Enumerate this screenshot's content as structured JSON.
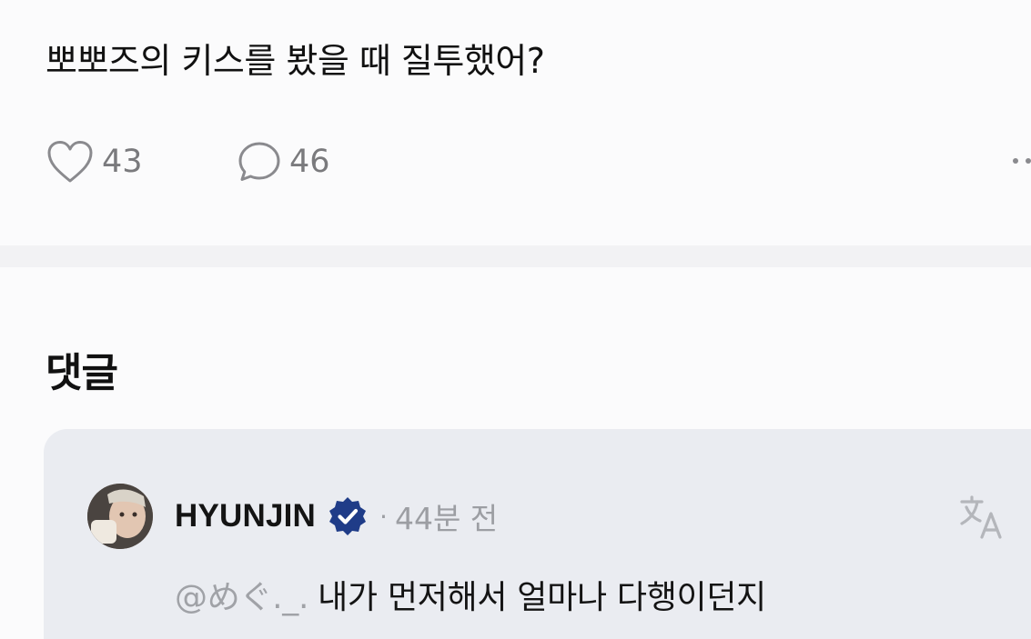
{
  "post": {
    "text": "뽀뽀즈의 키스를 봤을 때 질투했어?",
    "like_count": "43",
    "comment_count": "46",
    "icons": {
      "like": "heart-outline-icon",
      "comment": "speech-bubble-icon",
      "more": "more-horizontal-icon"
    }
  },
  "comments": {
    "heading": "댓글",
    "items": [
      {
        "author": "HYUNJIN",
        "verified": true,
        "separator": "·",
        "time": "44분 전",
        "mention": "@めぐ._.",
        "text": "내가 먼저해서 얼마나 다행이던지",
        "icons": {
          "verified": "verified-badge-icon",
          "translate": "translate-icon"
        }
      }
    ]
  },
  "colors": {
    "background": "#fbfbfc",
    "divider": "#f2f2f4",
    "comment_card": "#eaecf1",
    "verified_badge": "#1f3c88",
    "muted_text": "#9c9ea3"
  }
}
